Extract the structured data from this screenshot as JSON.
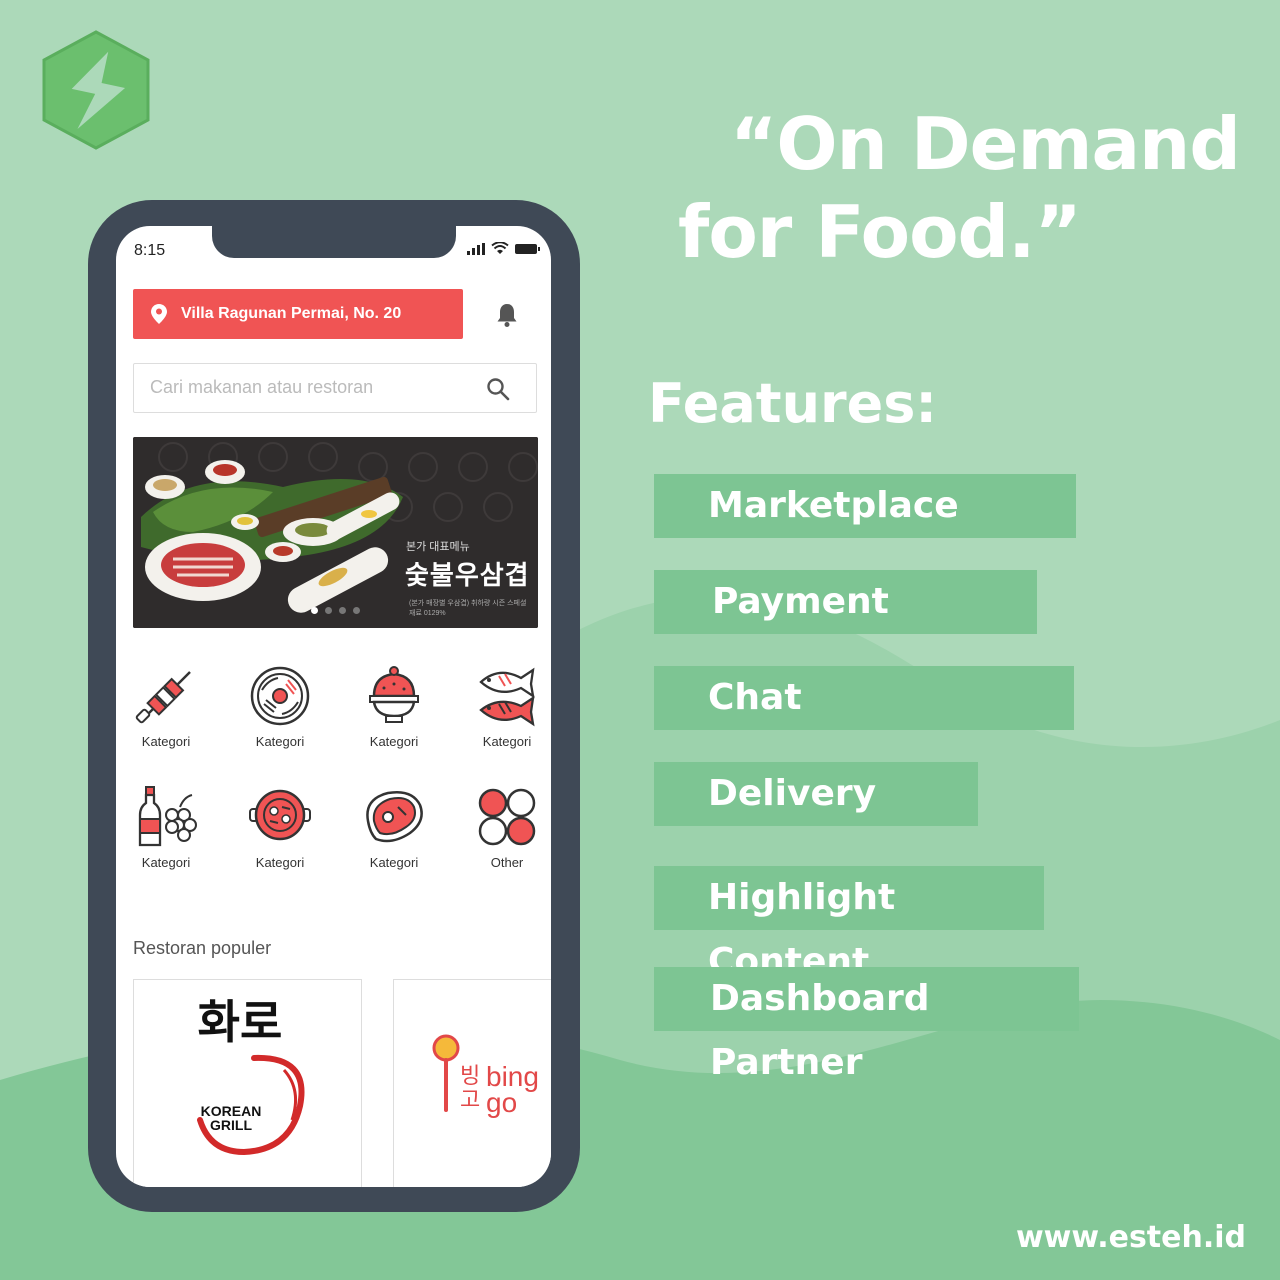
{
  "colors": {
    "background": "#acd9b9",
    "accent_green": "#7dc593",
    "logo_green": "#6bbf6e",
    "red": "#f05454",
    "phone_frame": "#3f4956"
  },
  "promo": {
    "headline_line1": "“On Demand",
    "headline_line2": "for Food.”",
    "features_title": "Features:",
    "features": [
      "Marketplace",
      "Payment",
      "Chat",
      "Delivery",
      "Highlight Content",
      "Dashboard Partner"
    ],
    "website": "www.esteh.id"
  },
  "app": {
    "status_time": "8:15",
    "location": "Villa Ragunan Permai, No. 20",
    "search_placeholder": "Cari makanan atau restoran",
    "banner": {
      "subtitle": "본가 대표메뉴",
      "title": "숯불우삼겹",
      "note": "(본가 매장별 우삼겹) 취하량 시즌 스페셜 재료 0129%"
    },
    "categories": [
      {
        "label": "Kategori",
        "icon": "skewer-icon"
      },
      {
        "label": "Kategori",
        "icon": "bibimbap-bowl-icon"
      },
      {
        "label": "Kategori",
        "icon": "shaved-ice-icon"
      },
      {
        "label": "Kategori",
        "icon": "fish-icon"
      },
      {
        "label": "Kategori",
        "icon": "soju-grapes-icon"
      },
      {
        "label": "Kategori",
        "icon": "hotpot-icon"
      },
      {
        "label": "Kategori",
        "icon": "steak-icon"
      },
      {
        "label": "Other",
        "icon": "other-circles-icon"
      }
    ],
    "popular_title": "Restoran populer",
    "restaurants": [
      {
        "name_ko": "화로",
        "name_en_1": "KOREAN",
        "name_en_2": "GRILL"
      },
      {
        "name_ko_1": "빙",
        "name_ko_2": "고",
        "name_en_1": "bing",
        "name_en_2": "go"
      }
    ]
  }
}
